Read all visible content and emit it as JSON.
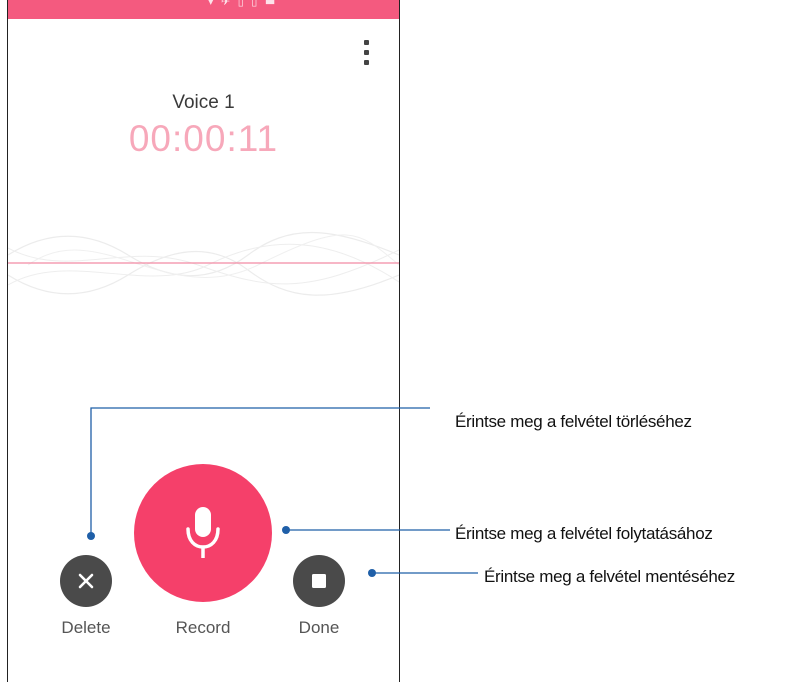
{
  "status_bar": {
    "glyphs": "▾ ✈ ▯ ▯ ▬"
  },
  "recorder": {
    "recording_name": "Voice 1",
    "timer": "00:00:11"
  },
  "controls": {
    "delete_label": "Delete",
    "record_label": "Record",
    "done_label": "Done"
  },
  "callouts": {
    "delete": "Érintse meg a felvétel törléséhez",
    "record": "Érintse meg a felvétel folytatásához",
    "done": "Érintse meg a felvétel mentéséhez"
  },
  "icons": {
    "overflow": "more-vert-icon",
    "delete": "close-icon",
    "record": "microphone-icon",
    "done": "stop-icon"
  },
  "colors": {
    "accent": "#f5406a",
    "status_bar": "#f45a7f",
    "timer": "#f7a8ba",
    "button_dark": "#4a4a4a",
    "callout_line": "#1f5fa8"
  }
}
